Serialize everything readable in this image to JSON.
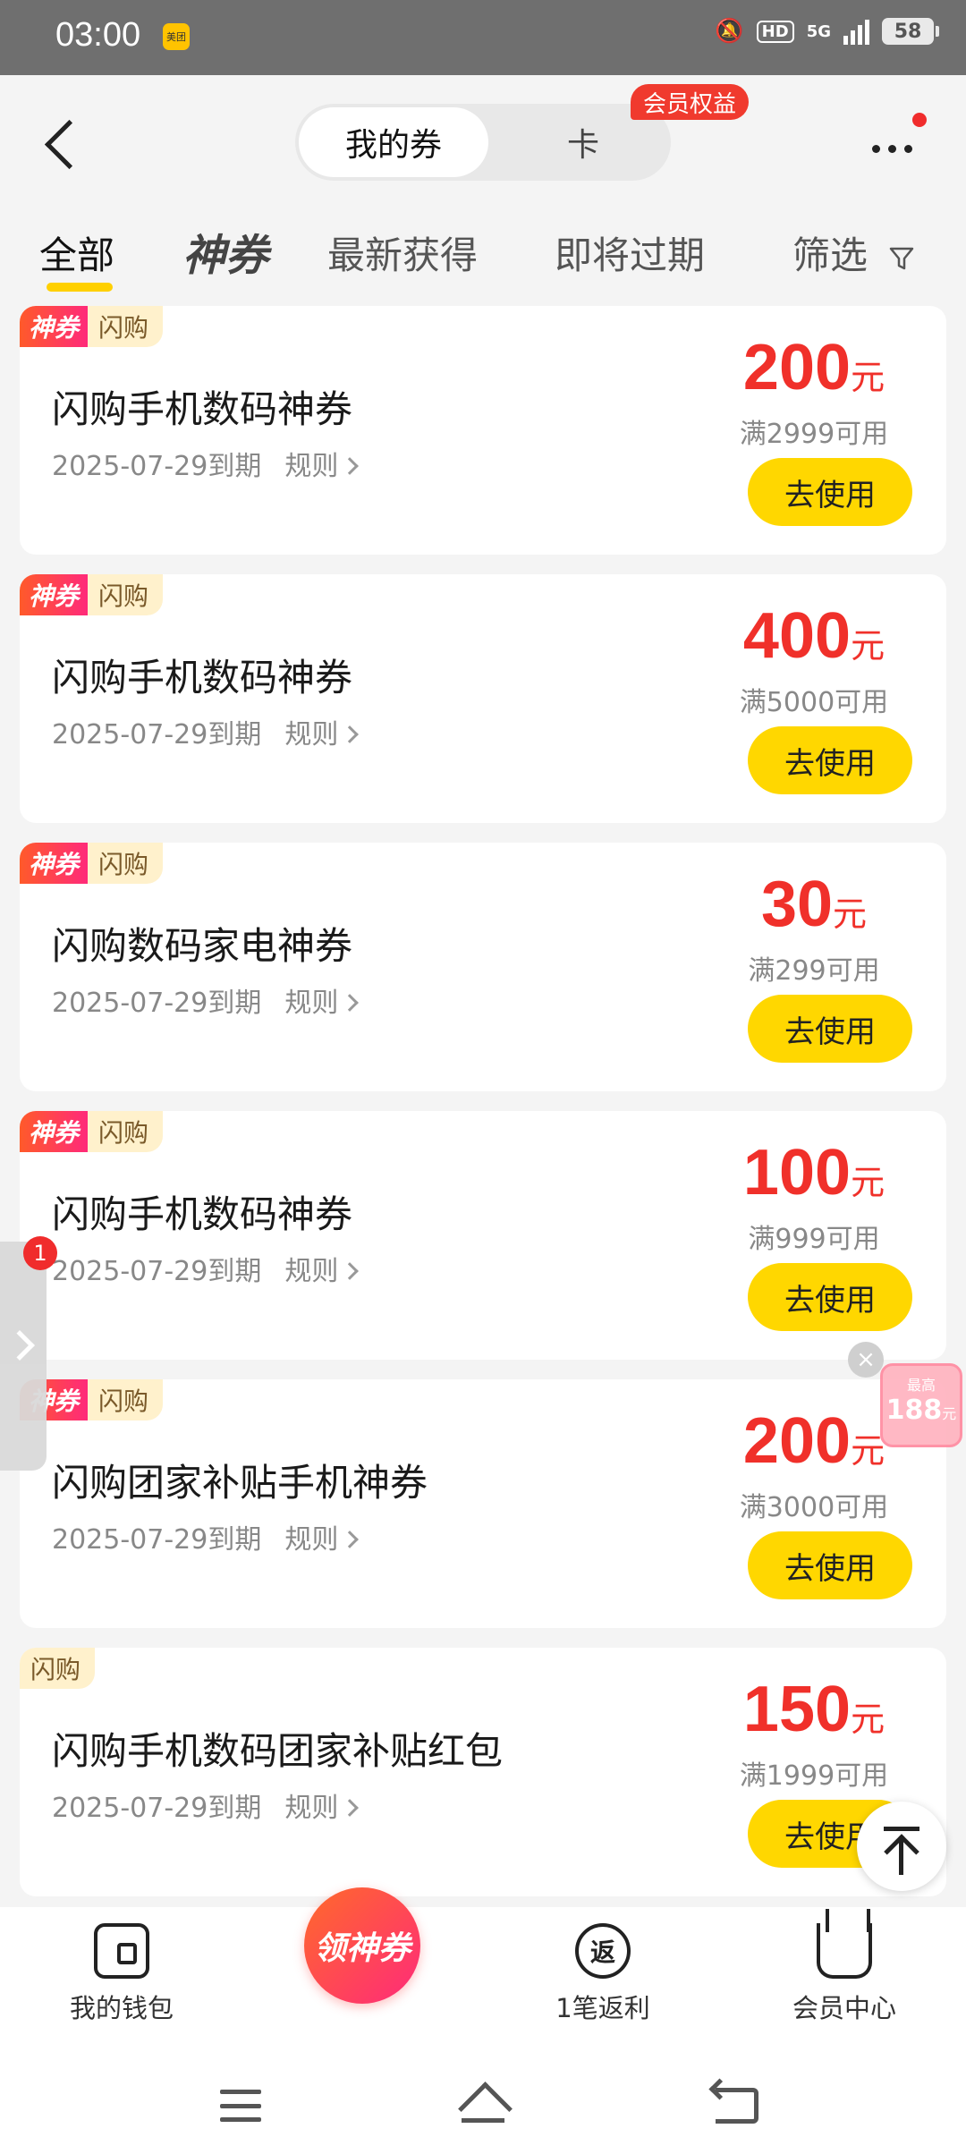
{
  "status": {
    "time": "03:00",
    "app_badge": "美团",
    "hd": "HD",
    "network": "5G",
    "battery": "58"
  },
  "header": {
    "tab_active": "我的券",
    "tab_other": "卡",
    "badge": "会员权益"
  },
  "filters": {
    "all": "全部",
    "shen": "神券",
    "newest": "最新获得",
    "expiring": "即将过期",
    "filter": "筛选"
  },
  "coupons": [
    {
      "tag_shen": "神券",
      "tag_flash": "闪购",
      "title": "闪购手机数码神券",
      "expiry": "2025-07-29到期",
      "rule": "规则",
      "amount": "200",
      "unit": "元",
      "condition": "满2999可用",
      "button": "去使用"
    },
    {
      "tag_shen": "神券",
      "tag_flash": "闪购",
      "title": "闪购手机数码神券",
      "expiry": "2025-07-29到期",
      "rule": "规则",
      "amount": "400",
      "unit": "元",
      "condition": "满5000可用",
      "button": "去使用"
    },
    {
      "tag_shen": "神券",
      "tag_flash": "闪购",
      "title": "闪购数码家电神券",
      "expiry": "2025-07-29到期",
      "rule": "规则",
      "amount": "30",
      "unit": "元",
      "condition": "满299可用",
      "button": "去使用"
    },
    {
      "tag_shen": "神券",
      "tag_flash": "闪购",
      "title": "闪购手机数码神券",
      "expiry": "2025-07-29到期",
      "rule": "规则",
      "amount": "100",
      "unit": "元",
      "condition": "满999可用",
      "button": "去使用"
    },
    {
      "tag_shen": "神券",
      "tag_flash": "闪购",
      "title": "闪购团家补贴手机神券",
      "expiry": "2025-07-29到期",
      "rule": "规则",
      "amount": "200",
      "unit": "元",
      "condition": "满3000可用",
      "button": "去使用"
    },
    {
      "tag_flash": "闪购",
      "title": "闪购手机数码团家补贴红包",
      "expiry": "2025-07-29到期",
      "rule": "规则",
      "amount": "150",
      "unit": "元",
      "condition": "满1999可用",
      "button": "去使用"
    }
  ],
  "floating": {
    "side_badge": "1",
    "promo_top": "最高",
    "promo_amount": "188",
    "promo_unit": "元"
  },
  "bottom": {
    "wallet": "我的钱包",
    "center": "领神券",
    "rebate_icon": "返",
    "rebate": "1笔返利",
    "member": "会员中心"
  }
}
